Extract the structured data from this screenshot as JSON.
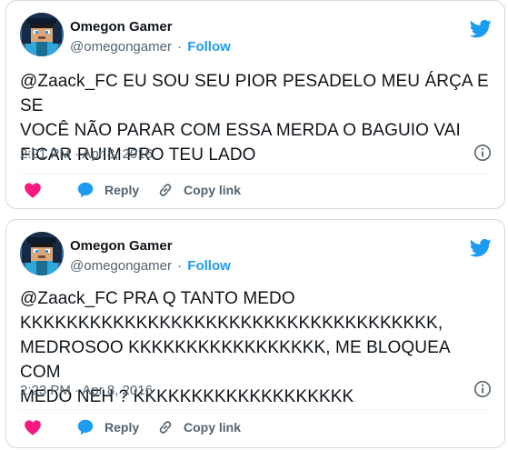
{
  "colors": {
    "accent": "#1d9bf0",
    "like": "#f91880",
    "text_primary": "#0f1419",
    "text_secondary": "#536471",
    "border": "#cfd9de"
  },
  "tweets": [
    {
      "author": {
        "name": "Omegon Gamer",
        "handle": "@omegongamer",
        "avatar_icon": "minecraft-avatar-icon"
      },
      "separator": "·",
      "follow_label": "Follow",
      "brand_icon": "twitter-bird-icon",
      "text": "@Zaack_FC EU SOU SEU PIOR PESADELO MEU ÁRÇA E SE\nVOCÊ NÃO PARAR COM ESSA MERDA O BAGUIO VAI\nFICAR RUIM PRO TEU LADO",
      "timestamp": "2:21 PM · Apr 8, 2016",
      "info_icon": "info-icon",
      "actions": {
        "like_icon": "heart-icon",
        "reply_label": "Reply",
        "reply_icon": "speech-bubble-icon",
        "copy_label": "Copy link",
        "copy_icon": "link-icon"
      }
    },
    {
      "author": {
        "name": "Omegon Gamer",
        "handle": "@omegongamer",
        "avatar_icon": "minecraft-avatar-icon"
      },
      "separator": "·",
      "follow_label": "Follow",
      "brand_icon": "twitter-bird-icon",
      "text": "@Zaack_FC PRA Q TANTO MEDO\nKKKKKKKKKKKKKKKKKKKKKKKKKKKKKKKKKKKK,\nMEDROSOO KKKKKKKKKKKKKKKKK, ME BLOQUEA COM\nMEDO NEH ? KKKKKKKKKKKKKKKKKKK",
      "timestamp": "2:23 PM · Apr 8, 2016",
      "info_icon": "info-icon",
      "actions": {
        "like_icon": "heart-icon",
        "reply_label": "Reply",
        "reply_icon": "speech-bubble-icon",
        "copy_label": "Copy link",
        "copy_icon": "link-icon"
      }
    }
  ]
}
